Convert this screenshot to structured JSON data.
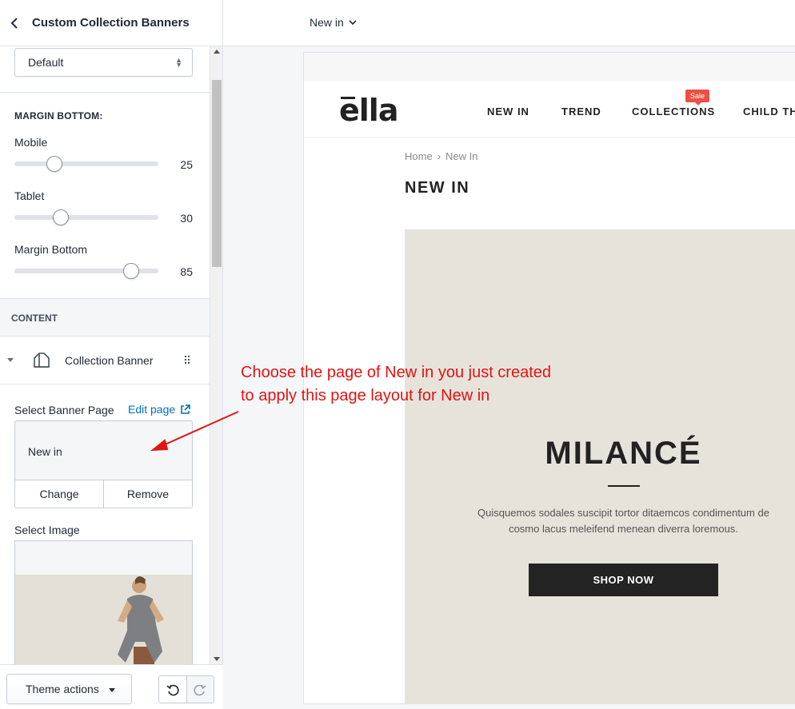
{
  "sidebar": {
    "title": "Custom Collection Banners",
    "select_value": "Default",
    "margin_section": "MARGIN BOTTOM:",
    "sliders": [
      {
        "label": "Mobile",
        "value": "25",
        "fraction": 0.28
      },
      {
        "label": "Tablet",
        "value": "30",
        "fraction": 0.33
      },
      {
        "label": "Margin Bottom",
        "value": "85",
        "fraction": 0.85
      }
    ],
    "content_header": "CONTENT",
    "block_name": "Collection Banner",
    "select_banner_label": "Select Banner Page",
    "edit_page_link": "Edit page",
    "selected_page": "New in",
    "change_button": "Change",
    "remove_button": "Remove",
    "select_image_label": "Select Image",
    "theme_actions": "Theme actions"
  },
  "topbar": {
    "page_selector": "New in"
  },
  "preview": {
    "logo": "ella",
    "nav": [
      "NEW IN",
      "TREND",
      "COLLECTIONS",
      "CHILD THE"
    ],
    "sale_badge": "Sale",
    "breadcrumb": {
      "home": "Home",
      "sep": "›",
      "current": "New In"
    },
    "page_title": "NEW IN",
    "banner": {
      "title": "MILANCÉ",
      "text_line1": "Quisquemos sodales suscipit tortor ditaemcos condimentum de",
      "text_line2": "cosmo lacus meleifend menean diverra loremous.",
      "button": "SHOP NOW"
    }
  },
  "annotation": {
    "line1": "Choose the page of New in you just created",
    "line2": "to apply this page layout for New in",
    "color": "#e01414"
  },
  "colors": {
    "link": "#006fbb",
    "sale": "#e95144",
    "banner_bg": "#e6e3da",
    "button_dark": "#232323"
  }
}
